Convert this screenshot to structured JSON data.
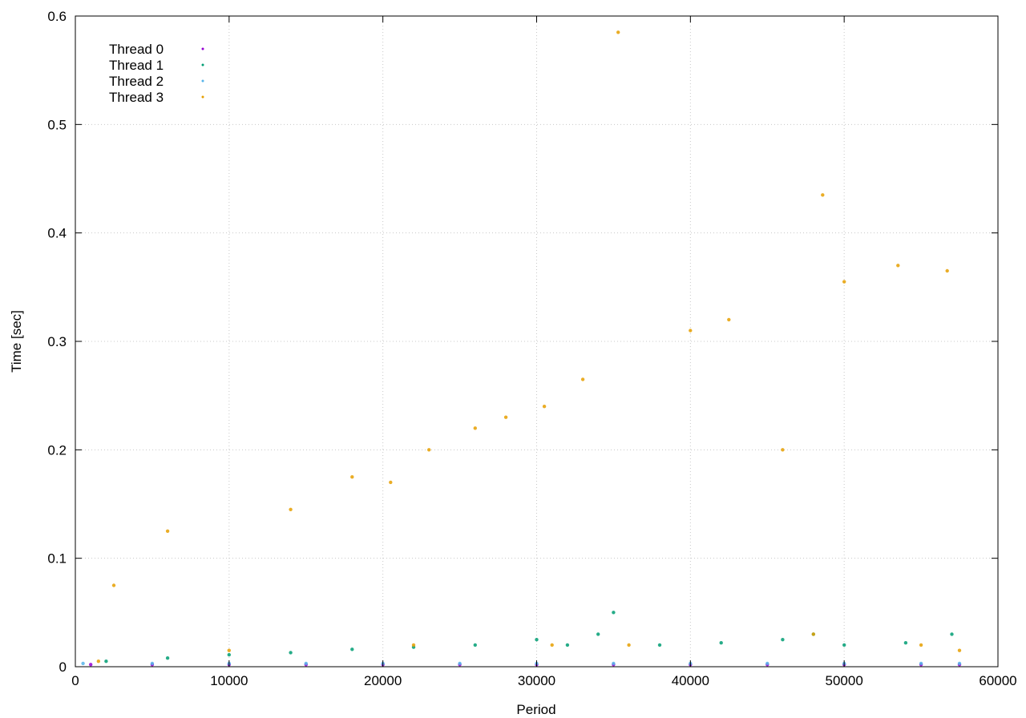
{
  "chart_data": {
    "type": "scatter",
    "title": "",
    "xlabel": "Period",
    "ylabel": "Time [sec]",
    "xlim": [
      0,
      60000
    ],
    "ylim": [
      0,
      0.6
    ],
    "x_ticks": [
      0,
      10000,
      20000,
      30000,
      40000,
      50000,
      60000
    ],
    "y_ticks": [
      0,
      0.1,
      0.2,
      0.3,
      0.4,
      0.5,
      0.6
    ],
    "x_tick_labels": [
      "0",
      "10000",
      "20000",
      "30000",
      "40000",
      "50000",
      "60000"
    ],
    "y_tick_labels": [
      "0",
      "0.1",
      "0.2",
      "0.3",
      "0.4",
      "0.5",
      "0.6"
    ],
    "grid": true,
    "legend_position": "top-left",
    "series": [
      {
        "name": "Thread 0",
        "color": "#9400d3",
        "marker": "dot",
        "x": [
          1000,
          5000,
          10000,
          15000,
          20000,
          25000,
          30000,
          35000,
          40000,
          45000,
          50000,
          55000,
          57500
        ],
        "y": [
          0.002,
          0.002,
          0.002,
          0.002,
          0.002,
          0.002,
          0.002,
          0.002,
          0.002,
          0.002,
          0.002,
          0.002,
          0.002
        ]
      },
      {
        "name": "Thread 1",
        "color": "#009e73",
        "marker": "dot",
        "x": [
          2000,
          6000,
          10000,
          14000,
          18000,
          22000,
          26000,
          30000,
          32000,
          34000,
          35000,
          38000,
          42000,
          46000,
          48000,
          50000,
          54000,
          57000
        ],
        "y": [
          0.005,
          0.008,
          0.011,
          0.013,
          0.016,
          0.018,
          0.02,
          0.025,
          0.02,
          0.03,
          0.05,
          0.02,
          0.022,
          0.025,
          0.03,
          0.02,
          0.022,
          0.03
        ]
      },
      {
        "name": "Thread 2",
        "color": "#56b4e9",
        "marker": "dot",
        "x": [
          500,
          5000,
          10000,
          15000,
          20000,
          25000,
          30000,
          35000,
          40000,
          45000,
          50000,
          55000,
          57500
        ],
        "y": [
          0.003,
          0.003,
          0.003,
          0.003,
          0.003,
          0.003,
          0.003,
          0.003,
          0.003,
          0.003,
          0.003,
          0.003,
          0.003
        ]
      },
      {
        "name": "Thread 3",
        "color": "#e69f00",
        "marker": "dot",
        "x": [
          1500,
          2500,
          6000,
          10000,
          14000,
          18000,
          20500,
          22000,
          23000,
          26000,
          28000,
          30500,
          31000,
          33000,
          35300,
          36000,
          40000,
          42500,
          46000,
          48000,
          48600,
          50000,
          53500,
          55000,
          56700,
          57500
        ],
        "y": [
          0.005,
          0.075,
          0.125,
          0.015,
          0.145,
          0.175,
          0.17,
          0.02,
          0.2,
          0.22,
          0.23,
          0.24,
          0.02,
          0.265,
          0.585,
          0.02,
          0.31,
          0.32,
          0.2,
          0.03,
          0.435,
          0.355,
          0.37,
          0.02,
          0.365,
          0.015
        ]
      }
    ],
    "legend_entries": [
      "Thread 0",
      "Thread 1",
      "Thread 2",
      "Thread 3"
    ]
  }
}
